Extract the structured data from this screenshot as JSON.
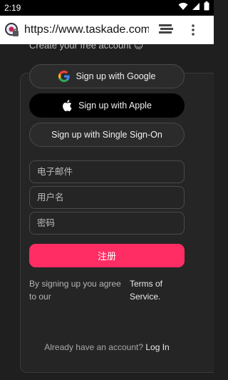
{
  "status_bar": {
    "time": "2:19"
  },
  "browser": {
    "url": "https://www.taskade.com"
  },
  "signup": {
    "subtitle": "Create your free account 😊",
    "google_label": "Sign up with Google",
    "apple_label": "Sign up with Apple",
    "sso_label": "Sign up with Single Sign-On",
    "email_placeholder": "电子邮件",
    "username_placeholder": "用户名",
    "password_placeholder": "密码",
    "submit_label": "注册",
    "agree_text": "By signing up you agree to our",
    "terms_label": "Terms of Service.",
    "login_prompt": "Already have an account?",
    "login_label": "Log In"
  },
  "colors": {
    "accent": "#ff2d63",
    "background": "#1f1f1f",
    "card": "#252525"
  },
  "icons": [
    "wifi-icon",
    "signal-icon",
    "battery-icon",
    "site-icon",
    "tabs-icon",
    "overflow-menu-icon",
    "google-icon",
    "apple-icon"
  ]
}
